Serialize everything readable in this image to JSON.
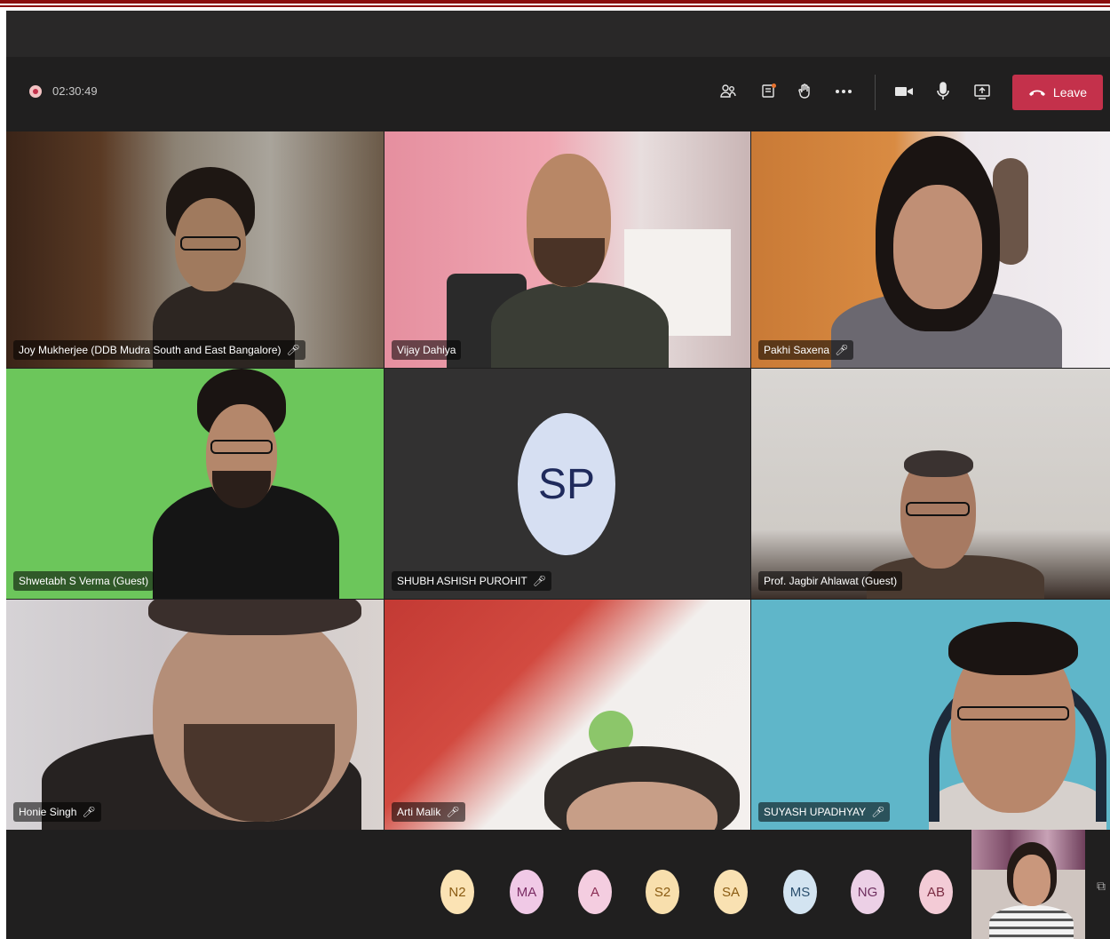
{
  "call": {
    "timer": "02:30:49",
    "leave_label": "Leave",
    "toolbar_icons": [
      "participants-icon",
      "chat-icon",
      "raise-hand-icon",
      "more-icon",
      "camera-icon",
      "microphone-icon",
      "share-screen-icon"
    ]
  },
  "tiles": [
    {
      "name": "Joy Mukherjee (DDB Mudra South and East Bangalore)",
      "muted": true
    },
    {
      "name": "Vijay Dahiya",
      "muted": false
    },
    {
      "name": "Pakhi Saxena",
      "muted": true
    },
    {
      "name": "Shwetabh S Verma (Guest)",
      "muted": false
    },
    {
      "name": "SHUBH ASHISH PUROHIT",
      "muted": true,
      "initials": "SP"
    },
    {
      "name": "Prof. Jagbir Ahlawat (Guest)",
      "muted": false
    },
    {
      "name": "Honie Singh",
      "muted": true
    },
    {
      "name": "Arti Malik",
      "muted": true
    },
    {
      "name": "SUYASH UPADHYAY",
      "muted": true
    }
  ],
  "roster": [
    {
      "initials": "N2",
      "color": "#fbe3b4"
    },
    {
      "initials": "MA",
      "color": "#f0c9e6"
    },
    {
      "initials": "A",
      "color": "#f4cde0"
    },
    {
      "initials": "S2",
      "color": "#f8dfad"
    },
    {
      "initials": "SA",
      "color": "#f9e1b2"
    },
    {
      "initials": "MS",
      "color": "#d3e4f1"
    },
    {
      "initials": "NG",
      "color": "#ecd0e6"
    },
    {
      "initials": "AB",
      "color": "#f3cbd6"
    }
  ],
  "colors": {
    "leave": "#c4314b",
    "background": "#201f1f",
    "accent_rule": "#8a0f0f"
  }
}
